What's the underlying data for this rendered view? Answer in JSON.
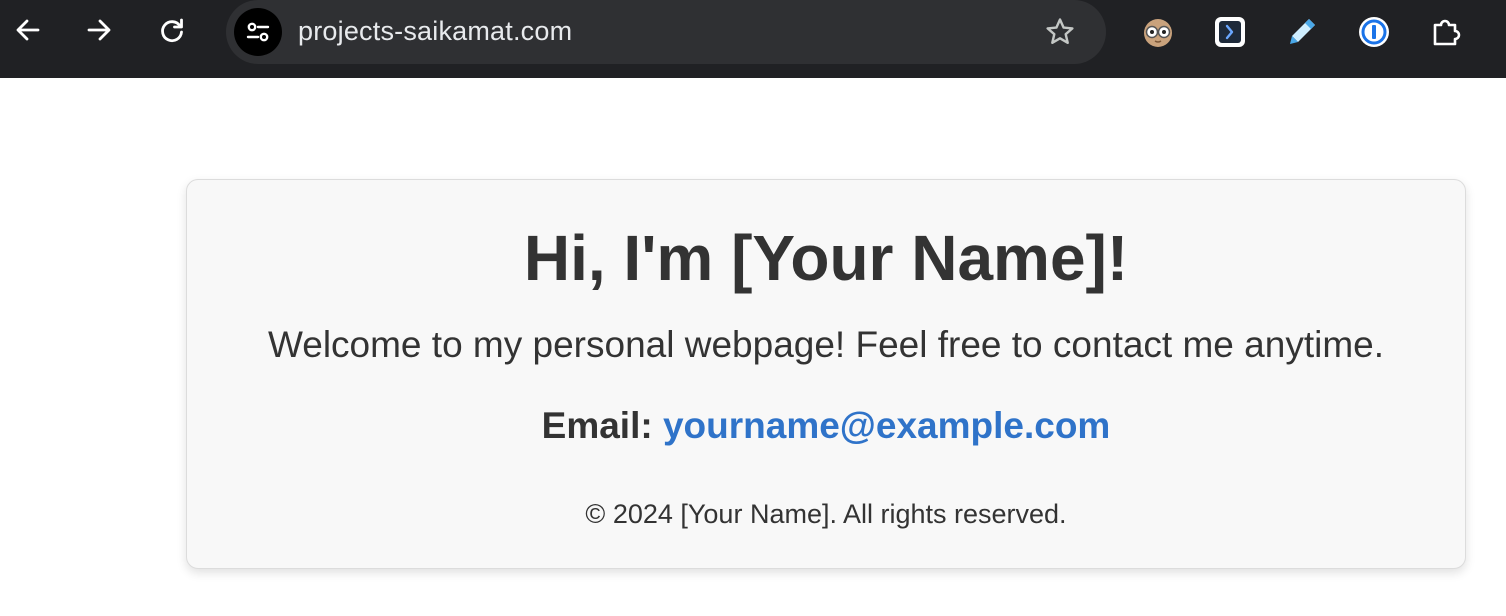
{
  "browser": {
    "url": "projects-saikamat.com",
    "icons": {
      "back": "arrow-left-icon",
      "forward": "arrow-right-icon",
      "reload": "reload-icon",
      "site_info": "tune-icon",
      "bookmark": "star-icon",
      "extensions": [
        "owl-glasses-icon",
        "code-bracket-icon",
        "highlighter-pen-icon",
        "password-manager-icon",
        "puzzle-piece-icon"
      ]
    }
  },
  "page": {
    "heading": "Hi, I'm [Your Name]!",
    "welcome": "Welcome to my personal webpage! Feel free to contact me anytime.",
    "email_label": "Email:",
    "email_value": "yourname@example.com",
    "copyright": "© 2024 [Your Name]. All rights reserved."
  },
  "colors": {
    "toolbar_bg": "#202124",
    "omnibox_bg": "#2f3033",
    "link": "#2f73c9",
    "text": "#333333",
    "card_bg": "#f8f8f8"
  }
}
